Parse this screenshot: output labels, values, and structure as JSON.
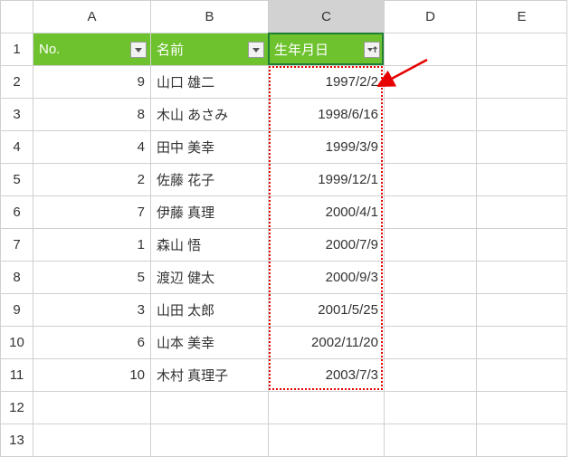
{
  "columns": [
    "A",
    "B",
    "C",
    "D",
    "E"
  ],
  "row_count": 13,
  "selected_col": "C",
  "selected_cell": "C1",
  "headers": {
    "A": "No.",
    "B": "名前",
    "C": "生年月日"
  },
  "filter_buttons": {
    "A": "dropdown",
    "B": "dropdown",
    "C": "sort-asc"
  },
  "rows": [
    {
      "no": 9,
      "name": "山口 雄二",
      "dob": "1997/2/2"
    },
    {
      "no": 8,
      "name": "木山 あさみ",
      "dob": "1998/6/16"
    },
    {
      "no": 4,
      "name": "田中 美幸",
      "dob": "1999/3/9"
    },
    {
      "no": 2,
      "name": "佐藤 花子",
      "dob": "1999/12/1"
    },
    {
      "no": 7,
      "name": "伊藤 真理",
      "dob": "2000/4/1"
    },
    {
      "no": 1,
      "name": "森山 悟",
      "dob": "2000/7/9"
    },
    {
      "no": 5,
      "name": "渡辺 健太",
      "dob": "2000/9/3"
    },
    {
      "no": 3,
      "name": "山田 太郎",
      "dob": "2001/5/25"
    },
    {
      "no": 6,
      "name": "山本 美幸",
      "dob": "2002/11/20"
    },
    {
      "no": 10,
      "name": "木村 真理子",
      "dob": "2003/7/3"
    }
  ],
  "marquee_range": "C2:C11",
  "annotation": {
    "type": "arrow",
    "target": "C2",
    "color": "#e60000"
  },
  "chart_data": {
    "type": "table",
    "columns": [
      "No.",
      "名前",
      "生年月日"
    ],
    "data": [
      [
        9,
        "山口 雄二",
        "1997/2/2"
      ],
      [
        8,
        "木山 あさみ",
        "1998/6/16"
      ],
      [
        4,
        "田中 美幸",
        "1999/3/9"
      ],
      [
        2,
        "佐藤 花子",
        "1999/12/1"
      ],
      [
        7,
        "伊藤 真理",
        "2000/4/1"
      ],
      [
        1,
        "森山 悟",
        "2000/7/9"
      ],
      [
        5,
        "渡辺 健太",
        "2000/9/3"
      ],
      [
        3,
        "山田 太郎",
        "2001/5/25"
      ],
      [
        6,
        "山本 美幸",
        "2002/11/20"
      ],
      [
        10,
        "木村 真理子",
        "2003/7/3"
      ]
    ]
  }
}
